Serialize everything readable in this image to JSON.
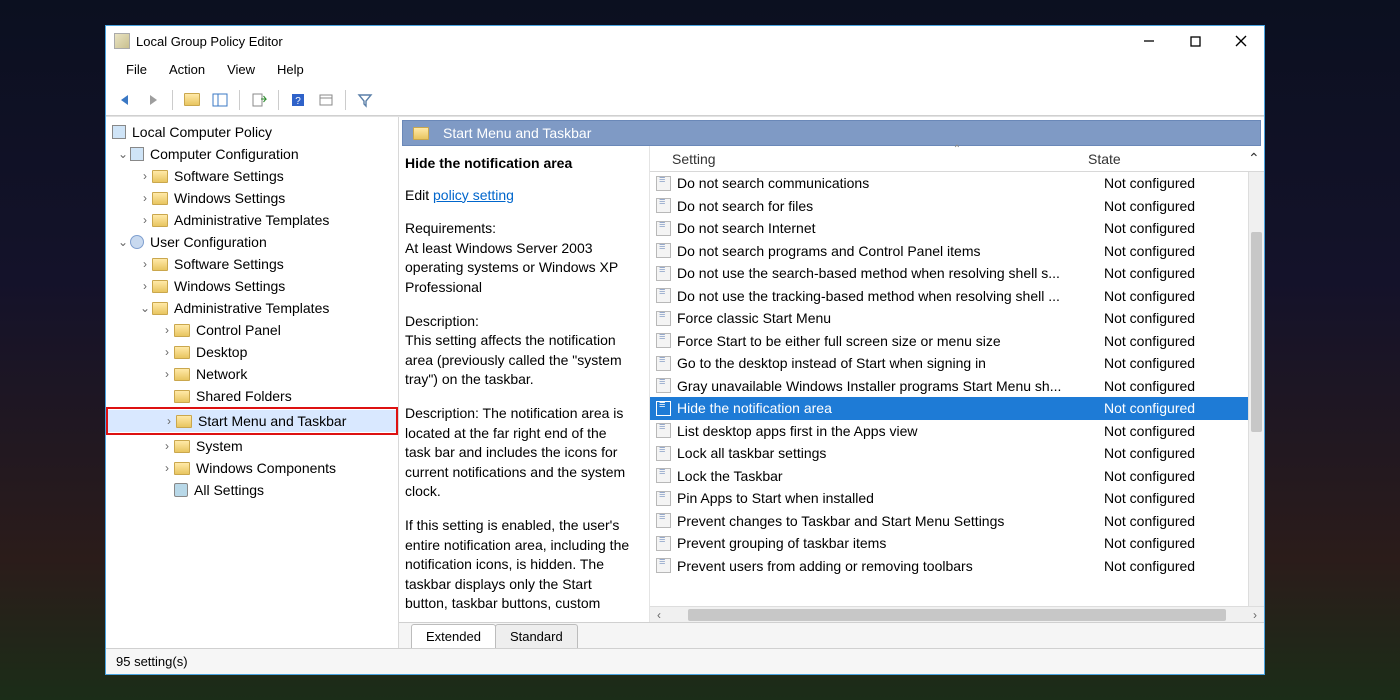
{
  "window": {
    "title": "Local Group Policy Editor"
  },
  "menu": {
    "file": "File",
    "action": "Action",
    "view": "View",
    "help": "Help"
  },
  "tree": {
    "root": "Local Computer Policy",
    "cc": "Computer Configuration",
    "cc_soft": "Software Settings",
    "cc_win": "Windows Settings",
    "cc_admin": "Administrative Templates",
    "uc": "User Configuration",
    "uc_soft": "Software Settings",
    "uc_win": "Windows Settings",
    "uc_admin": "Administrative Templates",
    "cp": "Control Panel",
    "desktop": "Desktop",
    "network": "Network",
    "shared": "Shared Folders",
    "startmenu": "Start Menu and Taskbar",
    "system": "System",
    "wincomp": "Windows Components",
    "allset": "All Settings"
  },
  "pane": {
    "title": "Start Menu and Taskbar",
    "heading": "Hide the notification area",
    "edit_label": "Edit",
    "link": "policy setting",
    "req_h": "Requirements:",
    "req_b": "At least Windows Server 2003 operating systems or Windows XP Professional",
    "desc_h": "Description:",
    "desc_a": "This setting affects the notification area (previously called the \"system tray\") on the taskbar.",
    "desc_b": "Description: The notification area is located at the far right end of the task bar and includes the icons for current notifications and the system clock.",
    "desc_c": "If this setting is enabled, the user's entire notification area, including the notification icons, is hidden. The taskbar displays only the Start button, taskbar buttons, custom"
  },
  "columns": {
    "setting": "Setting",
    "state": "State"
  },
  "settings": [
    {
      "name": "Do not search communications",
      "state": "Not configured",
      "sel": false
    },
    {
      "name": "Do not search for files",
      "state": "Not configured",
      "sel": false
    },
    {
      "name": "Do not search Internet",
      "state": "Not configured",
      "sel": false
    },
    {
      "name": "Do not search programs and Control Panel items",
      "state": "Not configured",
      "sel": false
    },
    {
      "name": "Do not use the search-based method when resolving shell s...",
      "state": "Not configured",
      "sel": false
    },
    {
      "name": "Do not use the tracking-based method when resolving shell ...",
      "state": "Not configured",
      "sel": false
    },
    {
      "name": "Force classic Start Menu",
      "state": "Not configured",
      "sel": false
    },
    {
      "name": "Force Start to be either full screen size or menu size",
      "state": "Not configured",
      "sel": false
    },
    {
      "name": "Go to the desktop instead of Start when signing in",
      "state": "Not configured",
      "sel": false
    },
    {
      "name": "Gray unavailable Windows Installer programs Start Menu sh...",
      "state": "Not configured",
      "sel": false
    },
    {
      "name": "Hide the notification area",
      "state": "Not configured",
      "sel": true
    },
    {
      "name": "List desktop apps first in the Apps view",
      "state": "Not configured",
      "sel": false
    },
    {
      "name": "Lock all taskbar settings",
      "state": "Not configured",
      "sel": false
    },
    {
      "name": "Lock the Taskbar",
      "state": "Not configured",
      "sel": false
    },
    {
      "name": "Pin Apps to Start when installed",
      "state": "Not configured",
      "sel": false
    },
    {
      "name": "Prevent changes to Taskbar and Start Menu Settings",
      "state": "Not configured",
      "sel": false
    },
    {
      "name": "Prevent grouping of taskbar items",
      "state": "Not configured",
      "sel": false
    },
    {
      "name": "Prevent users from adding or removing toolbars",
      "state": "Not configured",
      "sel": false
    }
  ],
  "tabs": {
    "extended": "Extended",
    "standard": "Standard"
  },
  "status": {
    "text": "95 setting(s)"
  }
}
